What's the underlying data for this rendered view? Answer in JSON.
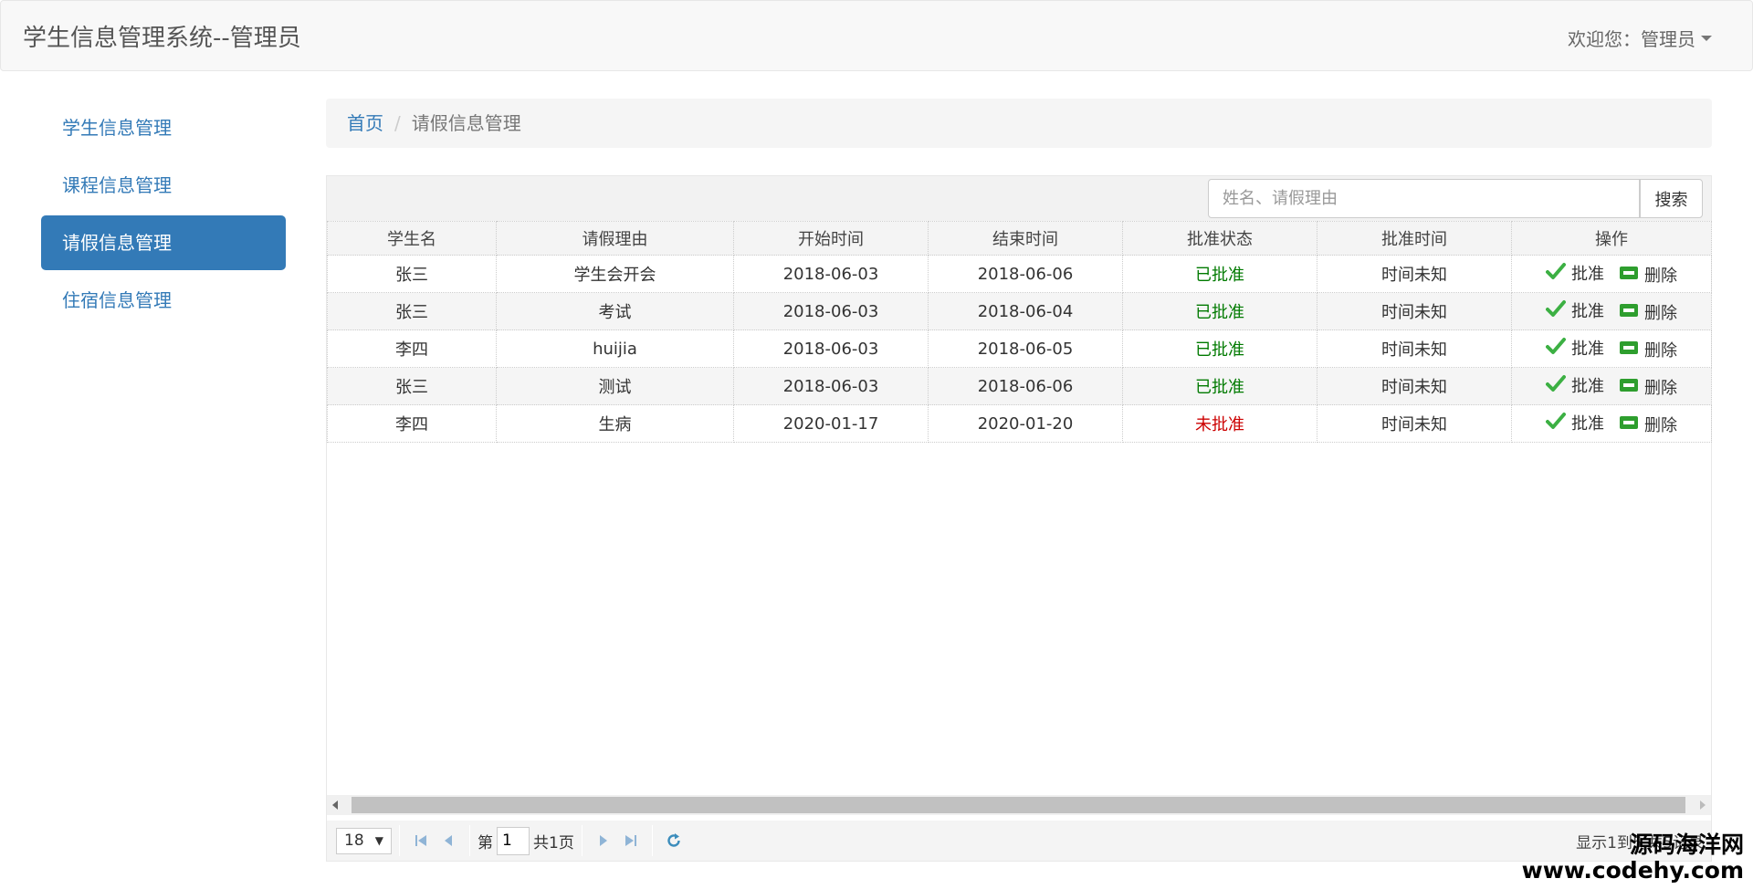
{
  "header": {
    "title": "学生信息管理系统--管理员",
    "welcome": "欢迎您：管理员"
  },
  "sidebar": {
    "items": [
      {
        "label": "学生信息管理",
        "active": false
      },
      {
        "label": "课程信息管理",
        "active": false
      },
      {
        "label": "请假信息管理",
        "active": true
      },
      {
        "label": "住宿信息管理",
        "active": false
      }
    ]
  },
  "breadcrumb": {
    "home": "首页",
    "separator": "/",
    "current": "请假信息管理"
  },
  "search": {
    "placeholder": "姓名、请假理由",
    "value": "",
    "button_label": "搜索"
  },
  "table": {
    "columns": [
      "学生名",
      "请假理由",
      "开始时间",
      "结束时间",
      "批准状态",
      "批准时间",
      "操作"
    ],
    "rows": [
      {
        "name": "张三",
        "reason": "学生会开会",
        "start": "2018-06-03",
        "end": "2018-06-06",
        "status": "已批准",
        "approved": true,
        "time": "时间未知"
      },
      {
        "name": "张三",
        "reason": "考试",
        "start": "2018-06-03",
        "end": "2018-06-04",
        "status": "已批准",
        "approved": true,
        "time": "时间未知"
      },
      {
        "name": "李四",
        "reason": "huijia",
        "start": "2018-06-03",
        "end": "2018-06-05",
        "status": "已批准",
        "approved": true,
        "time": "时间未知"
      },
      {
        "name": "张三",
        "reason": "测试",
        "start": "2018-06-03",
        "end": "2018-06-06",
        "status": "已批准",
        "approved": true,
        "time": "时间未知"
      },
      {
        "name": "李四",
        "reason": "生病",
        "start": "2020-01-17",
        "end": "2020-01-20",
        "status": "未批准",
        "approved": false,
        "time": "时间未知"
      }
    ],
    "actions": {
      "approve": "批准",
      "delete": "删除"
    }
  },
  "pager": {
    "page_size": "18",
    "page_prefix": "第",
    "page_number": "1",
    "page_total": "共1页",
    "info": "显示1到5,共5记录"
  },
  "colors": {
    "primary": "#337ab7",
    "approved": "#007a00",
    "not_approved": "#cc0000",
    "pager_icon": "#3c8dbc"
  },
  "icons": {
    "approve": "check-icon",
    "delete": "minus-box-icon",
    "first": "first-page-icon",
    "prev": "prev-page-icon",
    "next": "next-page-icon",
    "last": "last-page-icon",
    "refresh": "refresh-icon"
  },
  "watermark": {
    "line1": "源码海洋网",
    "line2": "www.codehy.com"
  }
}
